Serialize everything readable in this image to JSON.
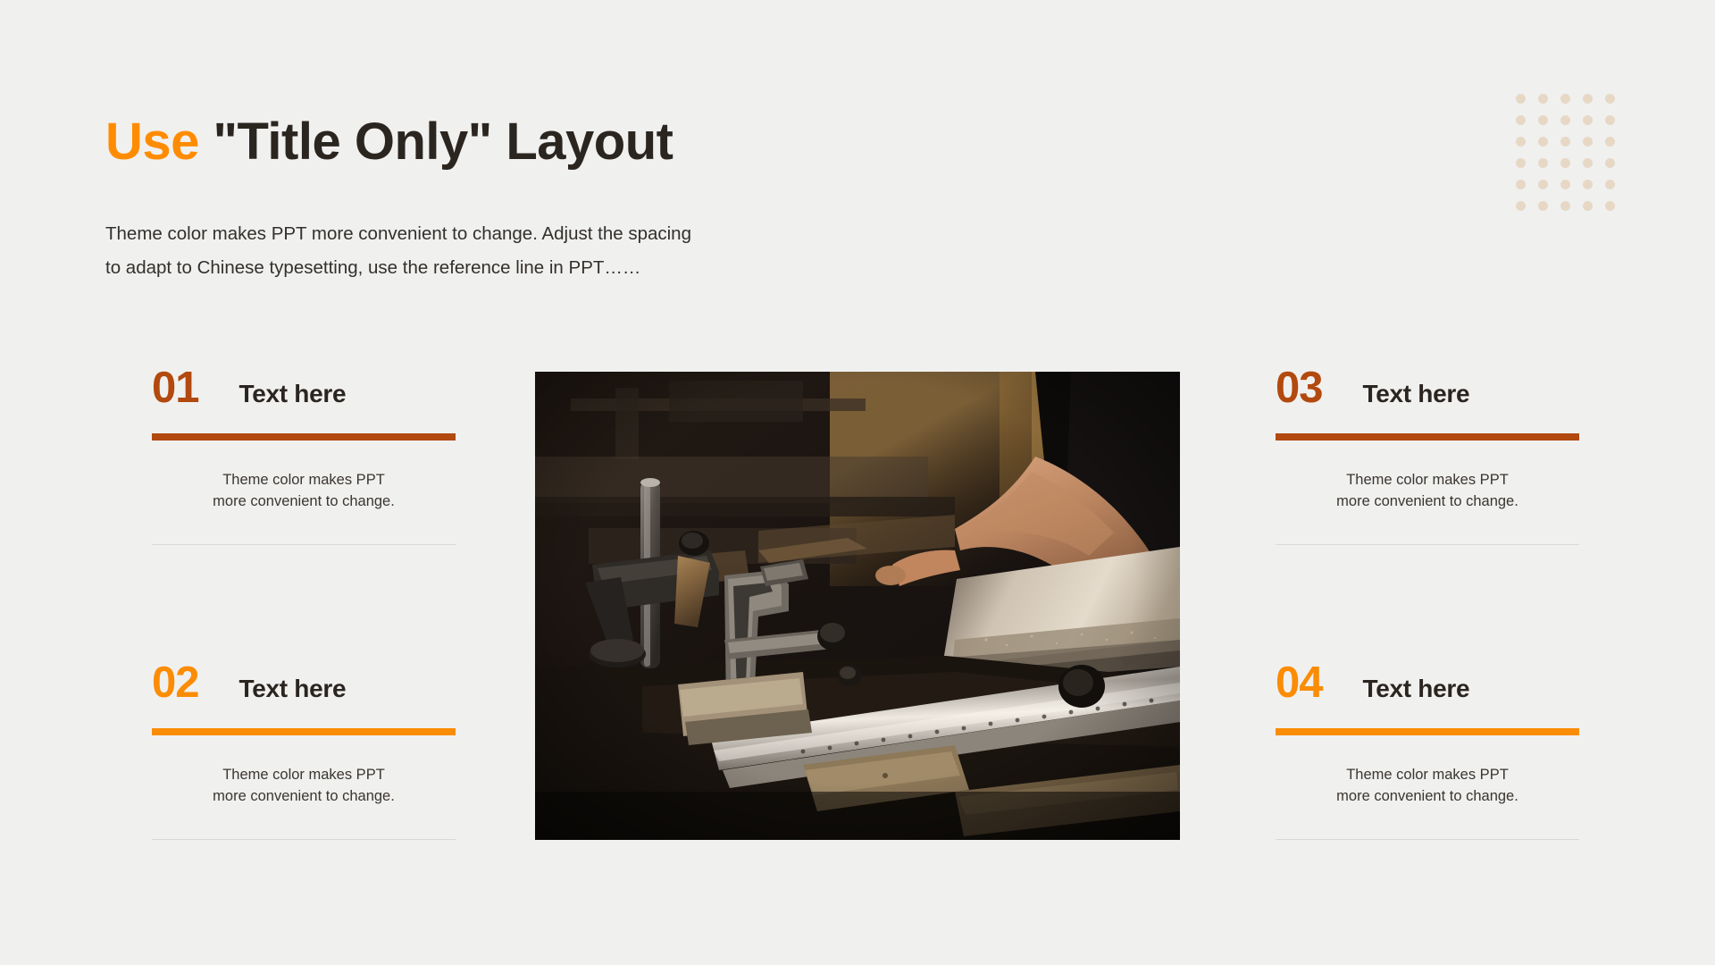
{
  "slide": {
    "background_color": "#f0f0ef",
    "title": {
      "accent_text": "Use",
      "rest_text": "\"Title Only\" Layout",
      "accent_color": "#ff8c00",
      "text_color": "#2b2520"
    },
    "subtitle": {
      "line1": "Theme color makes PPT more convenient to change. Adjust the spacing",
      "line2": "to adapt to Chinese typesetting, use the reference line in PPT……"
    },
    "decor": {
      "dot_grid_rows": 6,
      "dot_grid_cols": 5,
      "dot_color": "#e7d8c6"
    },
    "photo": {
      "alt": "Carpenter working with clamps on a woodworking table saw in a dim workshop"
    },
    "items": [
      {
        "number": "01",
        "title": "Text here",
        "body_line1": "Theme  color makes PPT",
        "body_line2": "more convenient  to change.",
        "color": "#b2490e"
      },
      {
        "number": "02",
        "title": "Text here",
        "body_line1": "Theme  color makes PPT",
        "body_line2": "more convenient  to change.",
        "color": "#fb8c05"
      },
      {
        "number": "03",
        "title": "Text here",
        "body_line1": "Theme  color makes PPT",
        "body_line2": "more convenient  to change.",
        "color": "#b2490e"
      },
      {
        "number": "04",
        "title": "Text here",
        "body_line1": "Theme  color makes PPT",
        "body_line2": "more convenient  to change.",
        "color": "#fb8c05"
      }
    ]
  }
}
